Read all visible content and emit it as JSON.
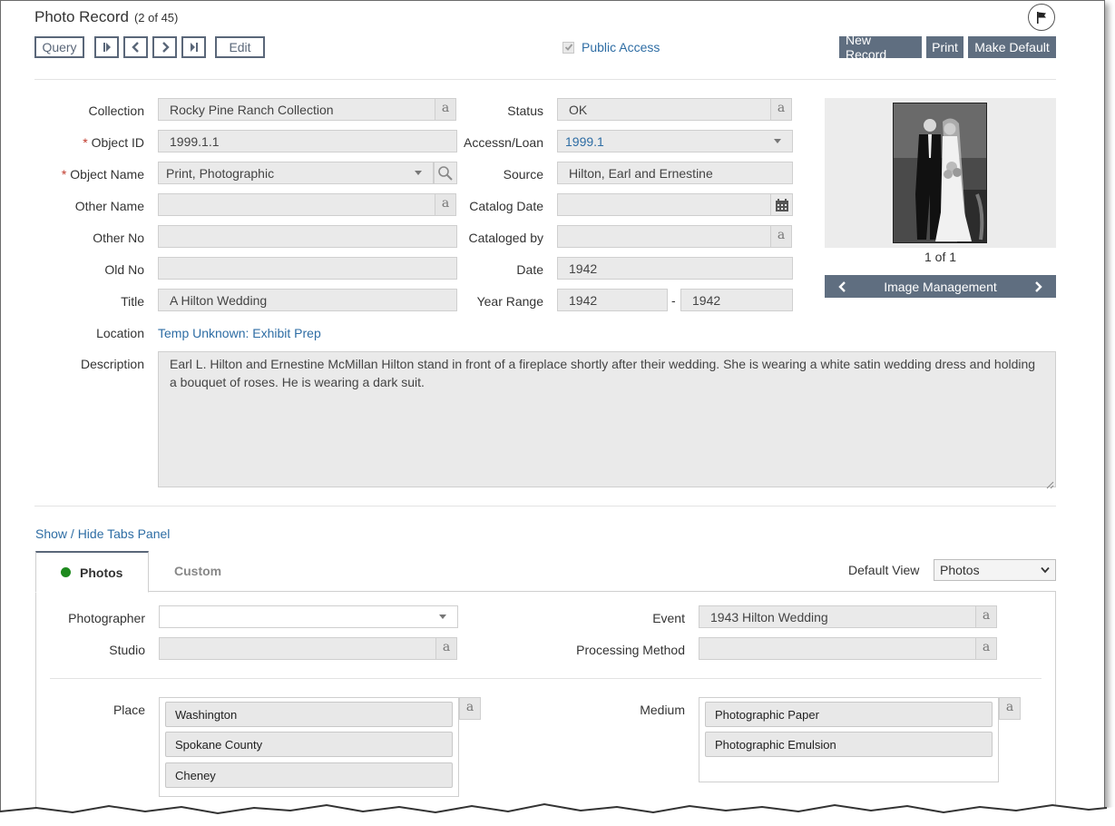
{
  "header": {
    "title": "Photo Record",
    "record_count": "(2 of 45)",
    "query_label": "Query",
    "edit_label": "Edit",
    "public_access_label": "Public Access",
    "new_record_label": "New Record",
    "print_label": "Print",
    "make_default_label": "Make Default"
  },
  "form": {
    "collection": {
      "label": "Collection",
      "value": "Rocky Pine Ranch Collection"
    },
    "object_id": {
      "label": "Object ID",
      "value": "1999.1.1"
    },
    "object_name": {
      "label": "Object Name",
      "value": "Print, Photographic"
    },
    "other_name": {
      "label": "Other Name",
      "value": ""
    },
    "other_no": {
      "label": "Other No",
      "value": ""
    },
    "old_no": {
      "label": "Old No",
      "value": ""
    },
    "title": {
      "label": "Title",
      "value": "A Hilton Wedding"
    },
    "location": {
      "label": "Location",
      "value": "Temp Unknown: Exhibit Prep"
    },
    "description": {
      "label": "Description",
      "value": "Earl L. Hilton and Ernestine McMillan Hilton stand in front of a fireplace shortly after their wedding.  She is wearing a white satin wedding dress and holding a bouquet of roses.  He is wearing a dark suit."
    },
    "status": {
      "label": "Status",
      "value": "OK"
    },
    "accessn": {
      "label": "Accessn/Loan",
      "value": "1999.1"
    },
    "source": {
      "label": "Source",
      "value": "Hilton, Earl and Ernestine"
    },
    "catalog_date": {
      "label": "Catalog Date",
      "value": ""
    },
    "cataloged_by": {
      "label": "Cataloged by",
      "value": ""
    },
    "date": {
      "label": "Date",
      "value": "1942"
    },
    "year_range": {
      "label": "Year Range",
      "from": "1942",
      "sep": "-",
      "to": "1942"
    },
    "a_glyph": "a"
  },
  "image_panel": {
    "counter": "1 of 1",
    "management_label": "Image Management"
  },
  "tabs": {
    "toggle_label": "Show / Hide Tabs Panel",
    "photos_label": "Photos",
    "custom_label": "Custom",
    "default_view_label": "Default View",
    "default_view_value": "Photos",
    "photographer": {
      "label": "Photographer",
      "value": ""
    },
    "studio": {
      "label": "Studio",
      "value": ""
    },
    "event": {
      "label": "Event",
      "value": "1943 Hilton Wedding"
    },
    "processing_method": {
      "label": "Processing Method",
      "value": ""
    },
    "place": {
      "label": "Place",
      "items": [
        "Washington",
        "Spokane County",
        "Cheney"
      ]
    },
    "medium": {
      "label": "Medium",
      "items": [
        "Photographic Paper",
        "Photographic Emulsion"
      ]
    }
  },
  "colors": {
    "accent": "#5f6e80",
    "link": "#2e6da4",
    "active_dot": "#1e8a1e",
    "required": "#c0392b"
  }
}
